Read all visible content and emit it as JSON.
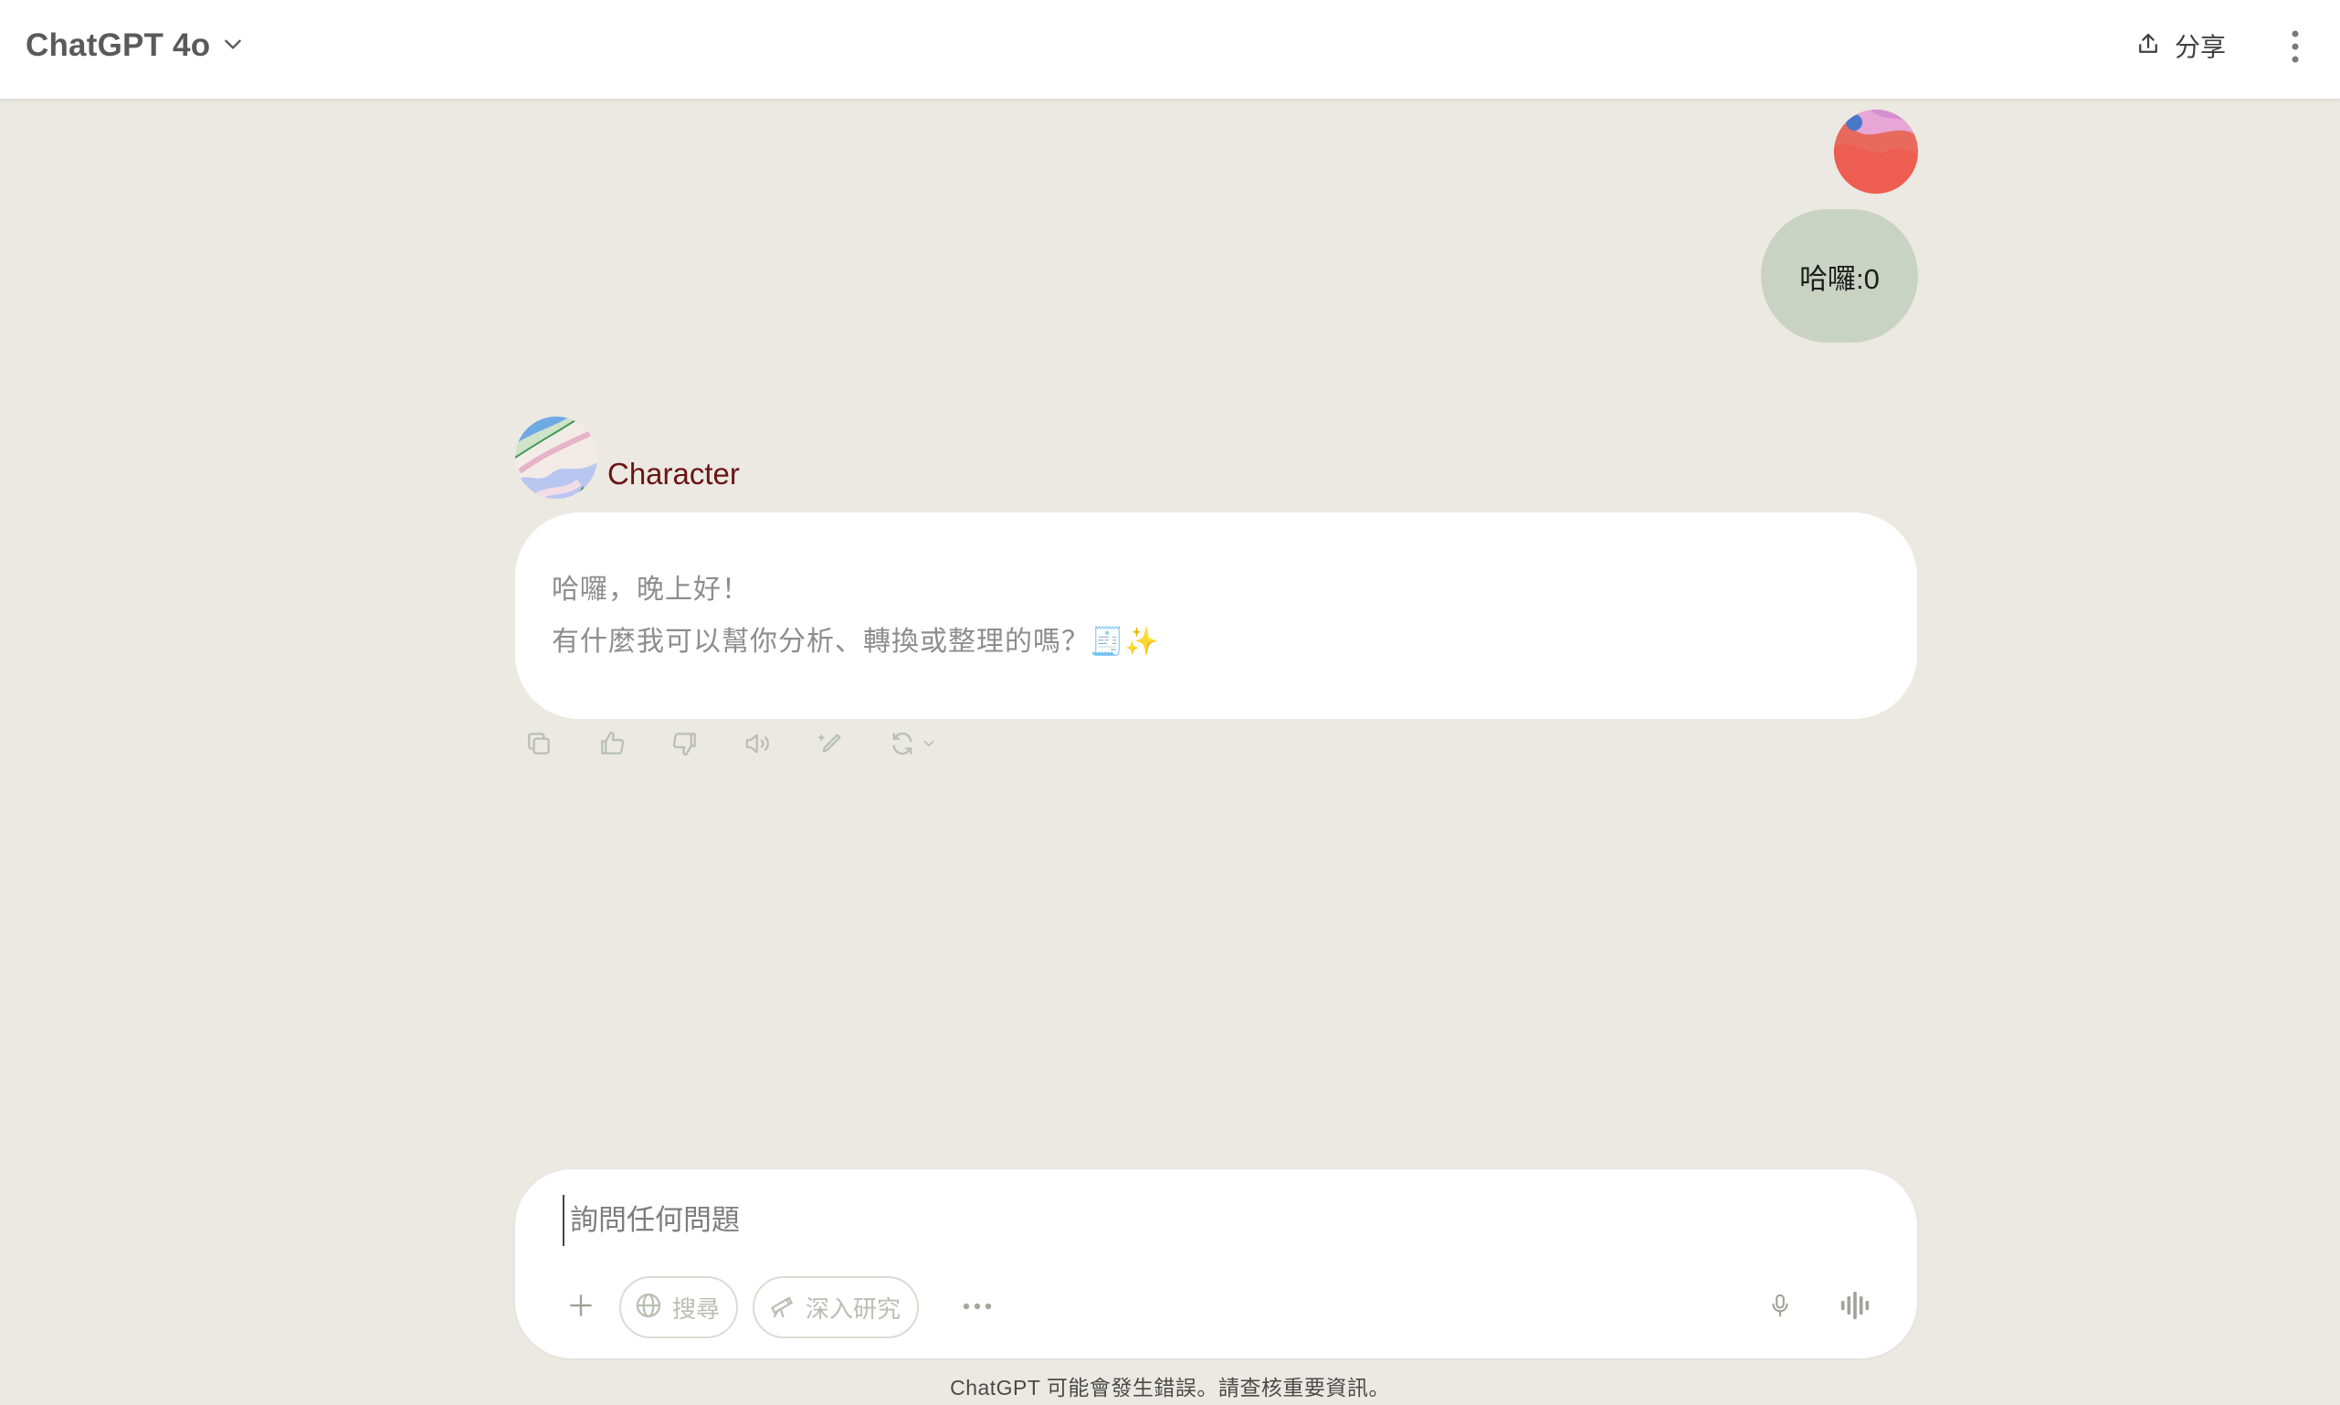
{
  "header": {
    "model_title": "ChatGPT 4o",
    "share_label": "分享"
  },
  "conversation": {
    "user_message": "哈囉:0",
    "assistant_name": "Character",
    "assistant_lines": [
      "哈囉，晚上好！",
      "有什麼我可以幫你分析、轉換或整理的嗎？🧾✨"
    ]
  },
  "message_actions": [
    {
      "name": "copy-icon"
    },
    {
      "name": "thumbs-up-icon"
    },
    {
      "name": "thumbs-down-icon"
    },
    {
      "name": "read-aloud-icon"
    },
    {
      "name": "edit-canvas-icon"
    },
    {
      "name": "regenerate-icon"
    }
  ],
  "composer": {
    "placeholder": "詢問任何問題",
    "search_label": "搜尋",
    "deep_research_label": "深入研究"
  },
  "footer": {
    "disclaimer": "ChatGPT 可能會發生錯誤。請查核重要資訊。"
  },
  "colors": {
    "background": "#ebe9e2",
    "user_bubble": "#c9d3c3",
    "assistant_name": "#6b1414",
    "pill_text": "#b8bfb2"
  }
}
